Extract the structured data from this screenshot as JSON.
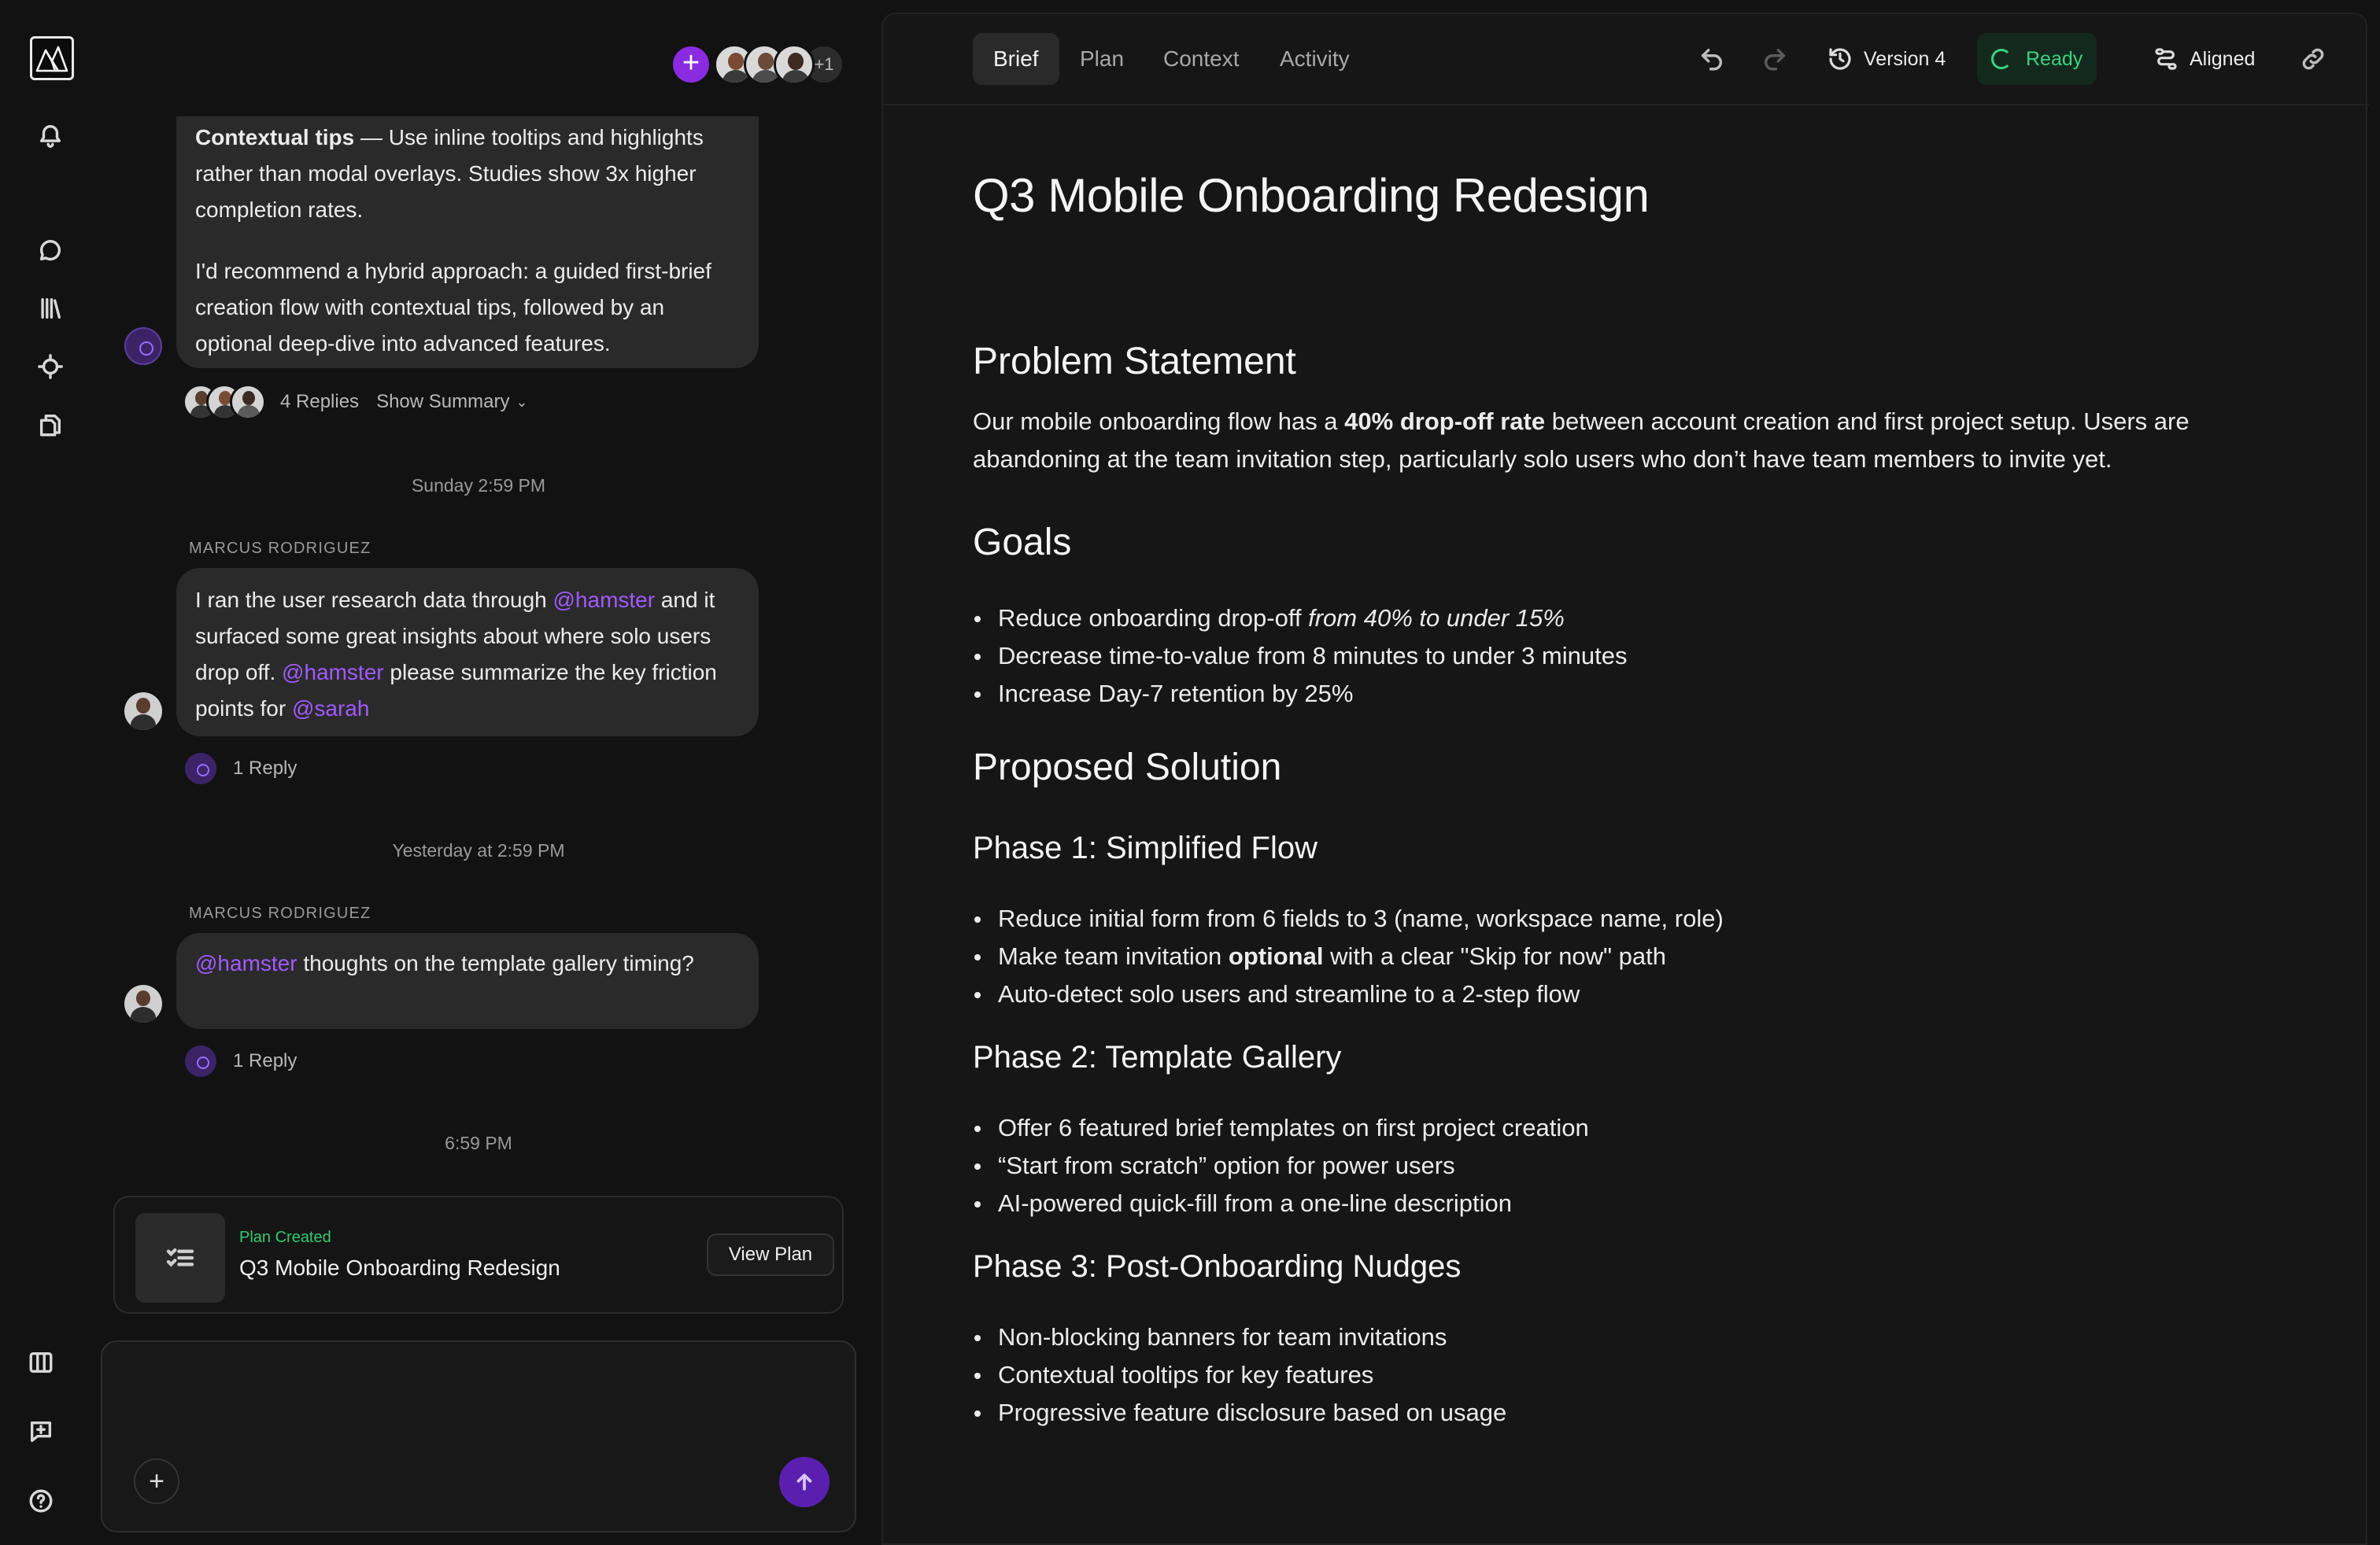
{
  "chat": {
    "collaborators_more": "+1",
    "messages": [
      {
        "tip_title": "Contextual tips",
        "tip_rest": " — Use inline tooltips and highlights rather than modal overlays. Studies show 3x higher completion rates.",
        "recommendation": "I'd recommend a hybrid approach: a guided first-brief creation flow with contextual tips, followed by an optional deep-dive into advanced features.",
        "replies_label": "4 Replies",
        "summary_label": "Show Summary"
      }
    ],
    "stamp_1": "Sunday 2:59 PM",
    "msg2": {
      "sender": "MARCUS RODRIGUEZ",
      "t1": "I ran the user research data through ",
      "m1": "@hamster",
      "t2": " and it surfaced some great insights about where solo users drop off. ",
      "m2": "@hamster",
      "t3": " please summarize the key friction points for ",
      "m3": "@sarah",
      "replies": "1 Reply"
    },
    "stamp_2": "Yesterday at 2:59 PM",
    "msg3": {
      "sender": "MARCUS RODRIGUEZ",
      "m1": "@hamster",
      "t1": " thoughts on the template gallery timing?",
      "replies": "1 Reply"
    },
    "stamp_3": "6:59 PM",
    "plan_card": {
      "label": "Plan Created",
      "title": "Q3 Mobile Onboarding Redesign",
      "button": "View Plan"
    }
  },
  "toolbar": {
    "tabs": [
      "Brief",
      "Plan",
      "Context",
      "Activity"
    ],
    "version": "Version 4",
    "status": "Ready",
    "alignment": "Aligned"
  },
  "doc": {
    "title": "Q3 Mobile Onboarding Redesign",
    "problem_heading": "Problem Statement",
    "problem_a": "Our mobile onboarding flow has a ",
    "problem_b": "40% drop-off rate",
    "problem_c": " between account creation and first project setup. Users are abandoning at the team invitation step, particularly solo users who don’t have team members to invite yet.",
    "goals_heading": "Goals",
    "goal_1a": "Reduce onboarding drop-off ",
    "goal_1b": "from 40% to under 15%",
    "goal_2": "Decrease time-to-value from 8 minutes to under 3 minutes",
    "goal_3": "Increase Day-7 retention by 25%",
    "solution_heading": "Proposed Solution",
    "phase1_heading": "Phase 1: Simplified Flow",
    "p1_1": "Reduce initial form from 6 fields to 3 (name, workspace name, role)",
    "p1_2a": "Make team invitation ",
    "p1_2b": "optional",
    "p1_2c": " with a clear \"Skip for now\" path",
    "p1_3": "Auto-detect solo users and streamline to a 2-step flow",
    "phase2_heading": "Phase 2: Template Gallery",
    "p2_1": "Offer 6 featured brief templates on first project creation",
    "p2_2": "“Start from scratch” option for power users",
    "p2_3": "AI-powered quick-fill from a one-line description",
    "phase3_heading": "Phase 3: Post-Onboarding Nudges",
    "p3_1": "Non-blocking banners for team invitations",
    "p3_2": "Contextual tooltips for key features",
    "p3_3": "Progressive feature disclosure based on usage"
  }
}
